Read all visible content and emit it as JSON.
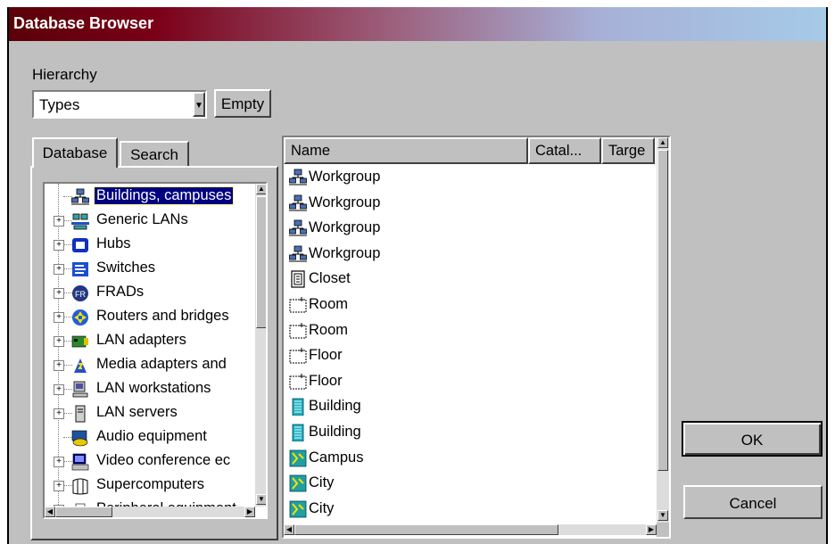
{
  "window": {
    "title": "Database Browser"
  },
  "hierarchy": {
    "label": "Hierarchy",
    "selected": "Types",
    "empty_button": "Empty"
  },
  "tabs": [
    {
      "label": "Database"
    },
    {
      "label": "Search"
    }
  ],
  "tree": {
    "items": [
      {
        "label": "Buildings, campuses",
        "icon": "workgroup-icon",
        "expander": false,
        "selected": true
      },
      {
        "label": "Generic LANs",
        "icon": "lan-icon",
        "expander": true
      },
      {
        "label": "Hubs",
        "icon": "hub-icon",
        "expander": true
      },
      {
        "label": "Switches",
        "icon": "switch-icon",
        "expander": true
      },
      {
        "label": "FRADs",
        "icon": "frad-icon",
        "expander": true
      },
      {
        "label": "Routers and bridges",
        "icon": "router-icon",
        "expander": true
      },
      {
        "label": "LAN adapters",
        "icon": "lan-adapter-icon",
        "expander": true
      },
      {
        "label": "Media adapters and",
        "icon": "media-adapter-icon",
        "expander": true
      },
      {
        "label": "LAN workstations",
        "icon": "workstation-icon",
        "expander": true
      },
      {
        "label": "LAN servers",
        "icon": "server-icon",
        "expander": true
      },
      {
        "label": "Audio equipment",
        "icon": "audio-icon",
        "expander": false
      },
      {
        "label": "Video conference ec",
        "icon": "video-conference-icon",
        "expander": true
      },
      {
        "label": "Supercomputers",
        "icon": "supercomputer-icon",
        "expander": true
      },
      {
        "label": "Peripheral equipment",
        "icon": "peripheral-icon",
        "expander": true
      }
    ]
  },
  "list": {
    "columns": [
      {
        "label": "Name"
      },
      {
        "label": "Catal..."
      },
      {
        "label": "Targe"
      }
    ],
    "rows": [
      {
        "name": "Workgroup",
        "icon": "workgroup-icon"
      },
      {
        "name": "Workgroup",
        "icon": "workgroup-icon"
      },
      {
        "name": "Workgroup",
        "icon": "workgroup-icon"
      },
      {
        "name": "Workgroup",
        "icon": "workgroup-icon"
      },
      {
        "name": "Closet",
        "icon": "closet-icon"
      },
      {
        "name": "Room",
        "icon": "room-icon"
      },
      {
        "name": "Room",
        "icon": "room-icon"
      },
      {
        "name": "Floor",
        "icon": "floor-icon"
      },
      {
        "name": "Floor",
        "icon": "floor-icon"
      },
      {
        "name": "Building",
        "icon": "building-icon"
      },
      {
        "name": "Building",
        "icon": "building-icon"
      },
      {
        "name": "Campus",
        "icon": "campus-icon"
      },
      {
        "name": "City",
        "icon": "city-icon"
      },
      {
        "name": "City",
        "icon": "city-icon"
      }
    ]
  },
  "buttons": {
    "ok": "OK",
    "cancel": "Cancel"
  },
  "colors": {
    "title_start": "#5a0008",
    "title_end": "#a6cae8",
    "selection": "#000080",
    "face": "#c0c0c0"
  }
}
